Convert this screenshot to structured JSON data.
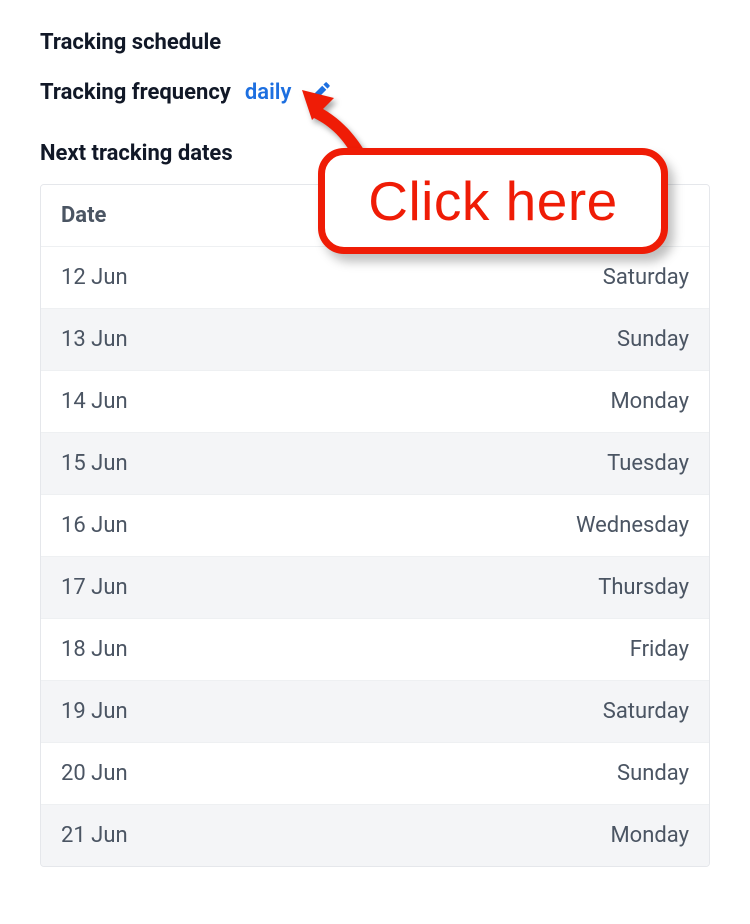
{
  "section_title": "Tracking schedule",
  "frequency": {
    "label": "Tracking frequency",
    "value": "daily"
  },
  "dates_title": "Next tracking dates",
  "table": {
    "header": "Date",
    "rows": [
      {
        "date": "12 Jun",
        "day": "Saturday"
      },
      {
        "date": "13 Jun",
        "day": "Sunday"
      },
      {
        "date": "14 Jun",
        "day": "Monday"
      },
      {
        "date": "15 Jun",
        "day": "Tuesday"
      },
      {
        "date": "16 Jun",
        "day": "Wednesday"
      },
      {
        "date": "17 Jun",
        "day": "Thursday"
      },
      {
        "date": "18 Jun",
        "day": "Friday"
      },
      {
        "date": "19 Jun",
        "day": "Saturday"
      },
      {
        "date": "20 Jun",
        "day": "Sunday"
      },
      {
        "date": "21 Jun",
        "day": "Monday"
      }
    ]
  },
  "callout": {
    "label": "Click here"
  },
  "colors": {
    "link_blue": "#1d6fe0",
    "callout_red": "#ef1c06",
    "row_alt_bg": "#f4f5f7",
    "text_muted": "#4b5563"
  }
}
